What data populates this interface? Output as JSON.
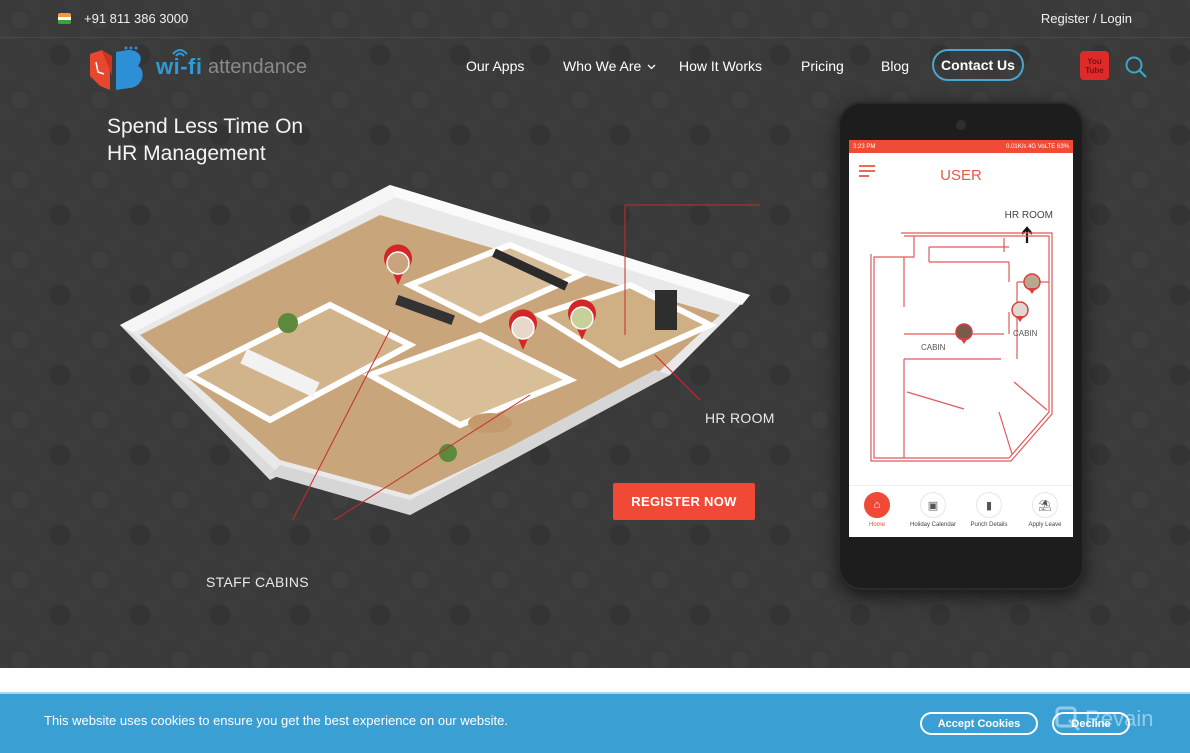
{
  "topbar": {
    "phone": "+91 811 386 3000",
    "register_label": "Register",
    "separator": "/",
    "login_label": "Login"
  },
  "logo": {
    "wifi_text": "wi-fi",
    "attendance_text": "attendance"
  },
  "nav": {
    "items": [
      {
        "label": "Our Apps"
      },
      {
        "label": "Who We Are",
        "has_dropdown": true
      },
      {
        "label": "How It Works"
      },
      {
        "label": "Pricing"
      },
      {
        "label": "Blog"
      }
    ],
    "contact_label": "Contact Us",
    "youtube_line1": "You",
    "youtube_line2": "Tube"
  },
  "hero": {
    "headline_line1": "Spend Less Time On",
    "headline_line2": "HR Management",
    "hr_room_label": "HR ROOM",
    "staff_cabins_label": "STAFF CABINS",
    "register_button": "REGISTER NOW"
  },
  "phone_app": {
    "status_time": "3:23 PM",
    "status_right": "0.01K/s  4G VoLTE  63%",
    "title": "USER",
    "hr_room": "HR ROOM",
    "cabin_left": "CABIN",
    "cabin_right": "CABIN",
    "tabs": [
      {
        "label": "Home",
        "icon": "home-icon",
        "active": true
      },
      {
        "label": "Holiday Calendar",
        "icon": "calendar-icon",
        "active": false
      },
      {
        "label": "Punch Details",
        "icon": "clipboard-icon",
        "active": false
      },
      {
        "label": "Apply Leave",
        "icon": "leave-icon",
        "active": false
      }
    ]
  },
  "cookie": {
    "message": "This website uses cookies to ensure you get the best experience on our website.",
    "accept_label": "Accept Cookies",
    "decline_label": "Decline"
  },
  "watermark": {
    "text": "Revain"
  },
  "colors": {
    "accent_red": "#f04a36",
    "brand_blue": "#2d9bd8",
    "cookie_bg": "#3aa0d3",
    "hero_bg": "#3a3a3a"
  }
}
